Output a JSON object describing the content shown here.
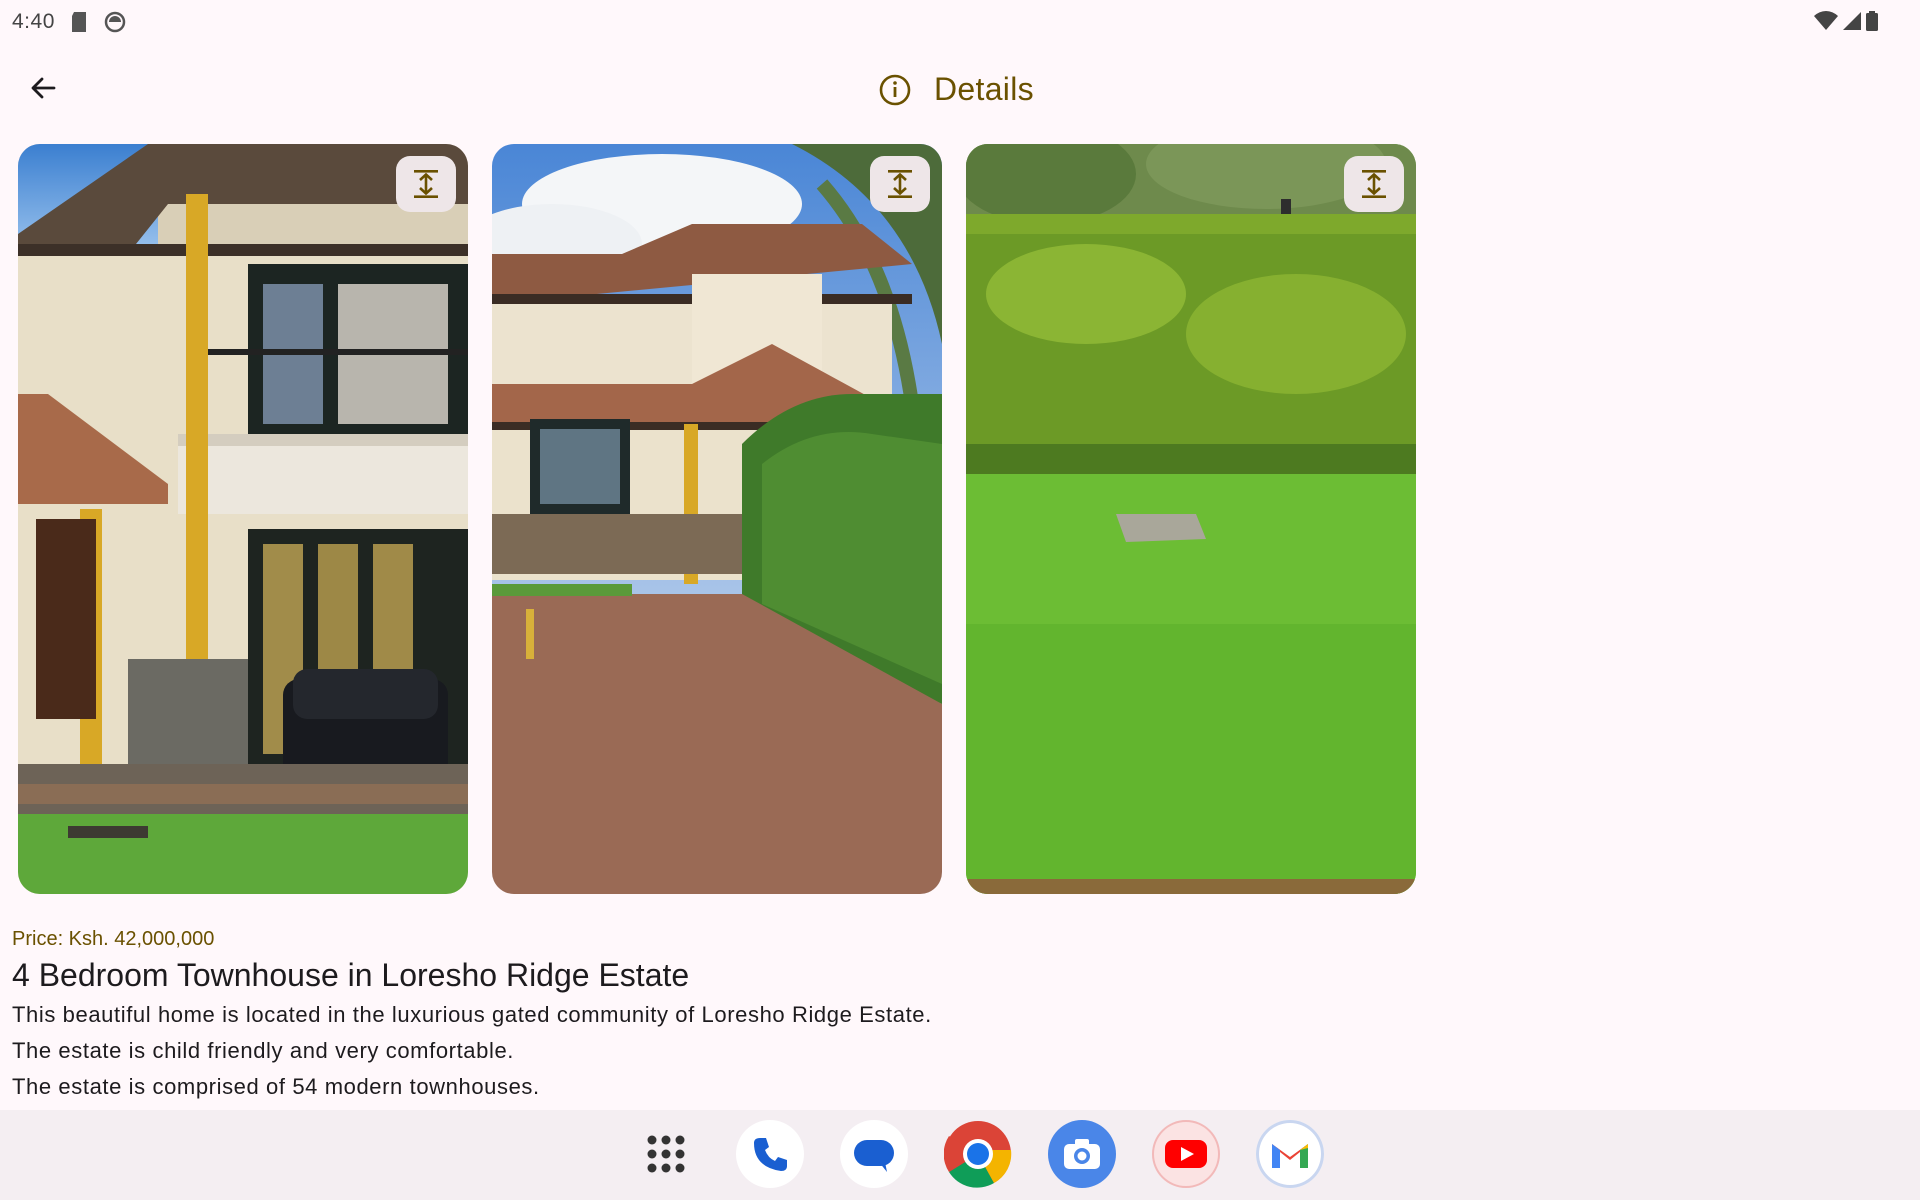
{
  "status_bar": {
    "time": "4:40"
  },
  "app_bar": {
    "title": "Details"
  },
  "gallery": {
    "photos": [
      {
        "subject": "townhouse-front-balcony"
      },
      {
        "subject": "townhouse-driveway-hedge"
      },
      {
        "subject": "garden-lawn-hedge"
      }
    ]
  },
  "listing": {
    "price": "Price: Ksh. 42,000,000",
    "title": "4 Bedroom Townhouse in Loresho Ridge Estate",
    "description": [
      "This beautiful home is located in the luxurious gated community of Loresho Ridge Estate.",
      "The estate is child friendly and very comfortable.",
      "The estate is comprised of 54 modern townhouses."
    ]
  },
  "colors": {
    "accent": "#6A5100",
    "background": "#FFF8FB",
    "dock_background": "#F4EEF2",
    "expand_button_bg": "#EEE6E8"
  },
  "dock": {
    "apps": [
      "app-drawer-icon",
      "phone-icon",
      "messages-icon",
      "chrome-icon",
      "camera-icon",
      "youtube-icon",
      "gmail-icon"
    ]
  }
}
